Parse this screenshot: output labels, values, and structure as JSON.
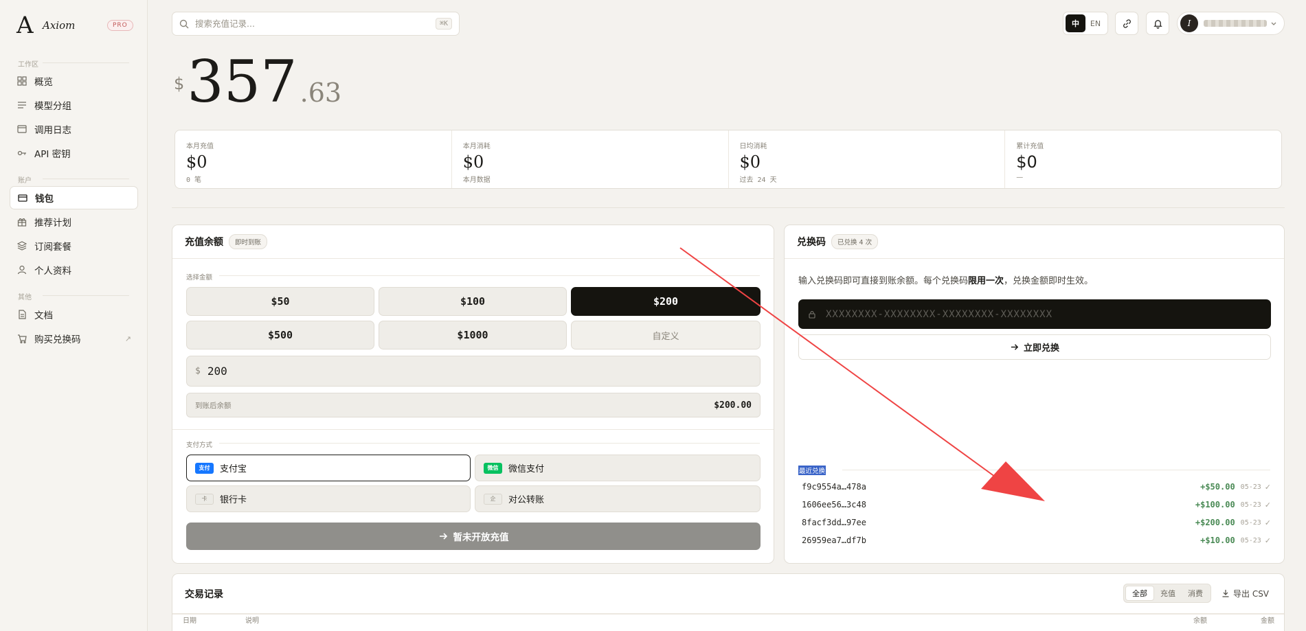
{
  "brand": {
    "logo": "A",
    "name": "Axiom",
    "badge": "PRO"
  },
  "sidebar": {
    "sections": [
      {
        "label": "工作区",
        "items": [
          {
            "label": "概览",
            "icon": "grid-icon"
          },
          {
            "label": "模型分组",
            "icon": "list-icon"
          },
          {
            "label": "调用日志",
            "icon": "log-icon"
          },
          {
            "label": "API 密钥",
            "icon": "key-icon"
          }
        ]
      },
      {
        "label": "账户",
        "items": [
          {
            "label": "钱包",
            "icon": "wallet-icon",
            "active": true
          },
          {
            "label": "推荐计划",
            "icon": "gift-icon"
          },
          {
            "label": "订阅套餐",
            "icon": "layers-icon"
          },
          {
            "label": "个人资料",
            "icon": "user-icon"
          }
        ]
      },
      {
        "label": "其他",
        "items": [
          {
            "label": "文档",
            "icon": "doc-icon"
          },
          {
            "label": "购买兑换码",
            "icon": "cart-icon",
            "external": "↗"
          }
        ]
      }
    ]
  },
  "topbar": {
    "search_placeholder": "搜索充值记录...",
    "shortcut": "⌘K",
    "lang": {
      "zh": "中",
      "en": "EN",
      "active": "zh"
    },
    "user_initial": "I"
  },
  "balance": {
    "currency": "$",
    "integer": "357",
    "decimal": ".63"
  },
  "stats": [
    {
      "label": "本月充值",
      "value": "$0",
      "sub": "0 笔"
    },
    {
      "label": "本月消耗",
      "value": "$0",
      "sub": "本月数据"
    },
    {
      "label": "日均消耗",
      "value": "$0",
      "sub": "过去 24 天"
    },
    {
      "label": "累计充值",
      "value": "$0",
      "sub": "—"
    }
  ],
  "topup": {
    "title": "充值余额",
    "badge": "即时到账",
    "amount_label": "选择金额",
    "amounts": [
      "$50",
      "$100",
      "$200",
      "$500",
      "$1000",
      "自定义"
    ],
    "selected_amount": "$200",
    "input_currency": "$",
    "input_value": "200",
    "after_label": "到账后余额",
    "after_value": "$200.00",
    "pay_label": "支付方式",
    "methods": [
      {
        "label": "支付宝",
        "tag": "支付",
        "color": "#1677ff",
        "selected": true
      },
      {
        "label": "微信支付",
        "tag": "微信",
        "color": "#07c160"
      },
      {
        "label": "银行卡",
        "tag": "卡"
      },
      {
        "label": "对公转账",
        "tag": "企"
      }
    ],
    "submit_label": "暂未开放充值"
  },
  "redeem": {
    "title": "兑换码",
    "badge": "已兑换 4 次",
    "desc_prefix": "输入兑换码即可直接到账余额。每个兑换码",
    "desc_bold": "限用一次",
    "desc_suffix": "，兑换金额即时生效。",
    "placeholder": "XXXXXXXX-XXXXXXXX-XXXXXXXX-XXXXXXXX",
    "button_label": "立即兑换",
    "recent_label": "最近兑换",
    "recent": [
      {
        "code": "f9c9554a…478a",
        "amount": "+$50.00",
        "date": "05-23",
        "check": "✓"
      },
      {
        "code": "1606ee56…3c48",
        "amount": "+$100.00",
        "date": "05-23",
        "check": "✓"
      },
      {
        "code": "8facf3dd…97ee",
        "amount": "+$200.00",
        "date": "05-23",
        "check": "✓"
      },
      {
        "code": "26959ea7…df7b",
        "amount": "+$10.00",
        "date": "05-23",
        "check": "✓"
      }
    ]
  },
  "transactions": {
    "title": "交易记录",
    "filters": [
      "全部",
      "充值",
      "消费"
    ],
    "active_filter": "全部",
    "export_label": "导出 CSV",
    "columns": [
      "日期",
      "说明",
      "余额",
      "金额"
    ]
  },
  "colors": {
    "accent_dark": "#15140f",
    "positive": "#4a8a55",
    "annotation_arrow": "#ef4444"
  }
}
